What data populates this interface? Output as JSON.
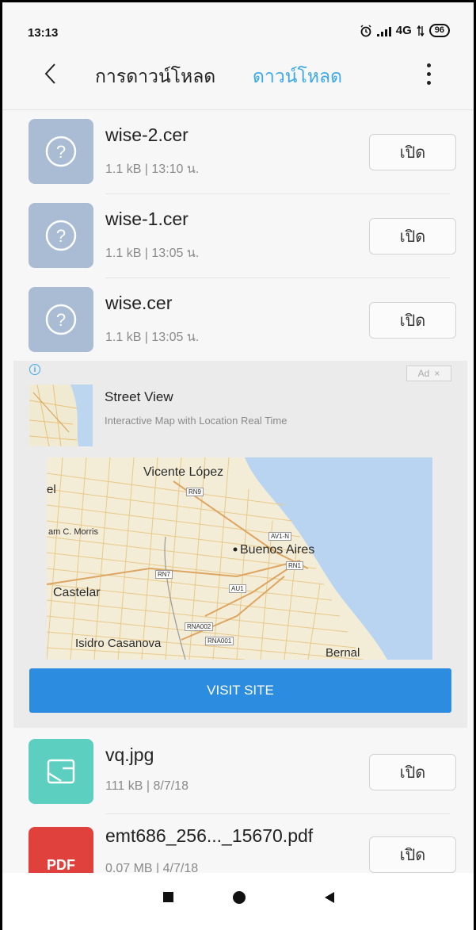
{
  "status_bar": {
    "time": "13:13",
    "network": "4G",
    "battery": "96",
    "alarm_icon": "alarm-icon"
  },
  "header": {
    "back_icon": "chevron-left-icon",
    "tab_downloads_label": "การดาวน์โหลด",
    "tab_active_label": "ดาวน์โหลด",
    "more_icon": "more-vertical-icon",
    "active_color": "#3ba9e6"
  },
  "files": [
    {
      "name": "wise-2.cer",
      "meta": "1.1 kB | 13:10 น.",
      "icon": "unknown-file-icon",
      "action": "เปิด"
    },
    {
      "name": "wise-1.cer",
      "meta": "1.1 kB | 13:05 น.",
      "icon": "unknown-file-icon",
      "action": "เปิด"
    },
    {
      "name": "wise.cer",
      "meta": "1.1 kB | 13:05 น.",
      "icon": "unknown-file-icon",
      "action": "เปิด"
    },
    {
      "name": "vq.jpg",
      "meta": "111 kB | 8/7/18",
      "icon": "image-file-icon",
      "action": "เปิด"
    },
    {
      "name": "emt686_256..._15670.pdf",
      "meta": "0.07 MB | 4/7/18",
      "icon": "pdf-file-icon",
      "icon_label": "PDF",
      "action": "เปิด"
    }
  ],
  "ad": {
    "info_icon": "info-icon",
    "badge": "Ad",
    "close": "×",
    "title": "Street View",
    "subtitle": "Interactive Map with Location Real Time",
    "map_labels": {
      "vicente_lopez": "Vicente López",
      "rn9": "RN9",
      "san_martin": "el",
      "jm_morris": "am C. Morris",
      "av1n": "AV1-N",
      "buenos_aires": "Buenos Aires",
      "rn1": "RN1",
      "rn7": "RN7",
      "au1": "AU1",
      "castelar": "Castelar",
      "rna002": "RNA002",
      "rna001": "RNA001",
      "isidro": "Isidro Casanova",
      "bernal": "Bernal"
    },
    "cta": "VISIT SITE",
    "cta_color": "#2c8de0"
  },
  "navbar": {
    "recents_icon": "square-icon",
    "home_icon": "circle-icon",
    "back_icon": "triangle-back-icon"
  }
}
